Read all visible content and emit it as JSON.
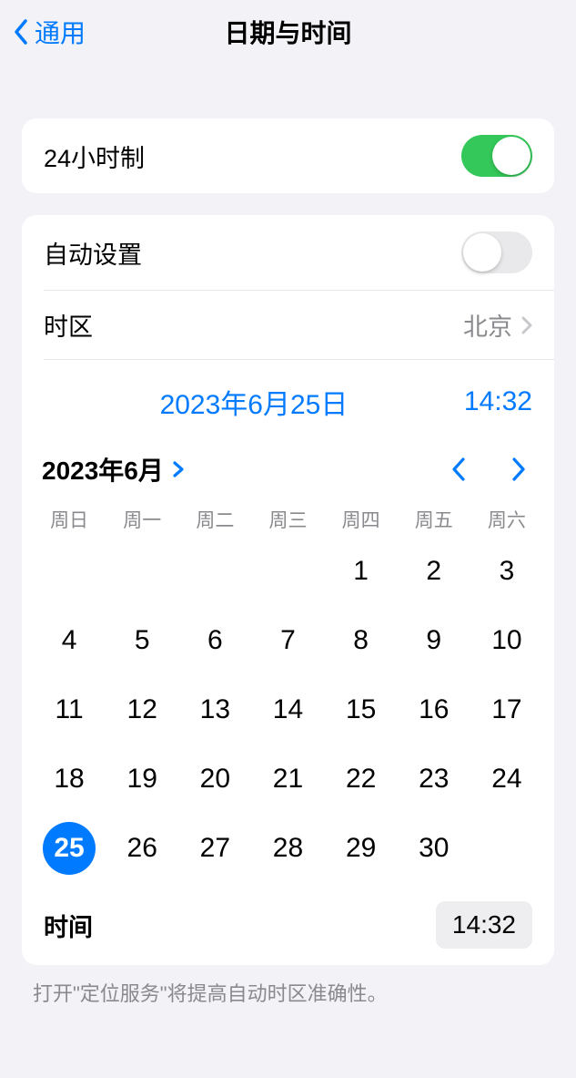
{
  "nav": {
    "back_label": "通用",
    "title": "日期与时间"
  },
  "twentyFour": {
    "label": "24小时制",
    "on": true
  },
  "autoSet": {
    "label": "自动设置",
    "on": false
  },
  "timezone": {
    "label": "时区",
    "value": "北京"
  },
  "dt": {
    "date": "2023年6月25日",
    "time": "14:32"
  },
  "cal": {
    "month_label": "2023年6月",
    "weekdays": [
      "周日",
      "周一",
      "周二",
      "周三",
      "周四",
      "周五",
      "周六"
    ],
    "leading_blanks": 4,
    "days": 30,
    "selected": 25
  },
  "timeRow": {
    "label": "时间",
    "value": "14:32"
  },
  "footnote": "打开\"定位服务\"将提高自动时区准确性。"
}
